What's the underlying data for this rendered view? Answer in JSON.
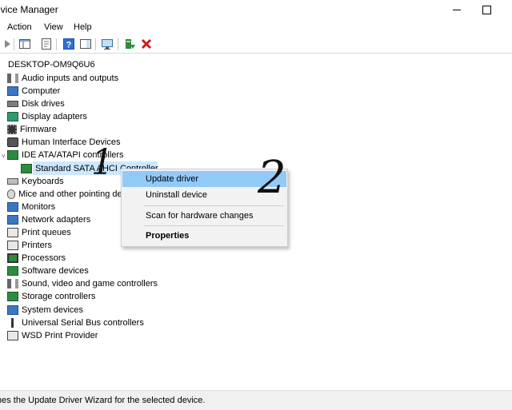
{
  "window": {
    "title": "Device Manager",
    "title_visible": "evice Manager"
  },
  "menu": {
    "items": [
      "Action",
      "View",
      "Help"
    ]
  },
  "tree": {
    "root": "DESKTOP-OM9Q6U6",
    "nodes": [
      {
        "label": "Audio inputs and outputs",
        "icon": "speaker-icon"
      },
      {
        "label": "Computer",
        "icon": "computer-icon"
      },
      {
        "label": "Disk drives",
        "icon": "disk-drive-icon"
      },
      {
        "label": "Display adapters",
        "icon": "display-adapter-icon"
      },
      {
        "label": "Firmware",
        "icon": "firmware-icon"
      },
      {
        "label": "Human Interface Devices",
        "icon": "hid-icon"
      },
      {
        "label": "IDE ATA/ATAPI controllers",
        "icon": "ide-controller-icon"
      },
      {
        "label": "Standard SATA AHCI Controller",
        "icon": "controller-icon"
      },
      {
        "label": "Keyboards",
        "icon": "keyboard-icon"
      },
      {
        "label": "Mice and other pointing devices",
        "icon": "mouse-icon"
      },
      {
        "label": "Monitors",
        "icon": "monitor-icon"
      },
      {
        "label": "Network adapters",
        "icon": "network-adapter-icon"
      },
      {
        "label": "Print queues",
        "icon": "print-queue-icon"
      },
      {
        "label": "Printers",
        "icon": "printer-icon"
      },
      {
        "label": "Processors",
        "icon": "processor-icon"
      },
      {
        "label": "Software devices",
        "icon": "software-device-icon"
      },
      {
        "label": "Sound, video and game controllers",
        "icon": "sound-icon"
      },
      {
        "label": "Storage controllers",
        "icon": "storage-controller-icon"
      },
      {
        "label": "System devices",
        "icon": "system-device-icon"
      },
      {
        "label": "Universal Serial Bus controllers",
        "icon": "usb-icon"
      },
      {
        "label": "WSD Print Provider",
        "icon": "wsd-print-icon"
      }
    ]
  },
  "context_menu": {
    "items": [
      {
        "label": "Update driver"
      },
      {
        "label": "Uninstall device"
      },
      {
        "label": "Scan for hardware changes"
      },
      {
        "label": "Properties"
      }
    ]
  },
  "annotations": [
    "1",
    "2"
  ],
  "status": {
    "text": "Launches the Update Driver Wizard for the selected device.",
    "visible_text": "hes the Update Driver Wizard for the selected device."
  }
}
